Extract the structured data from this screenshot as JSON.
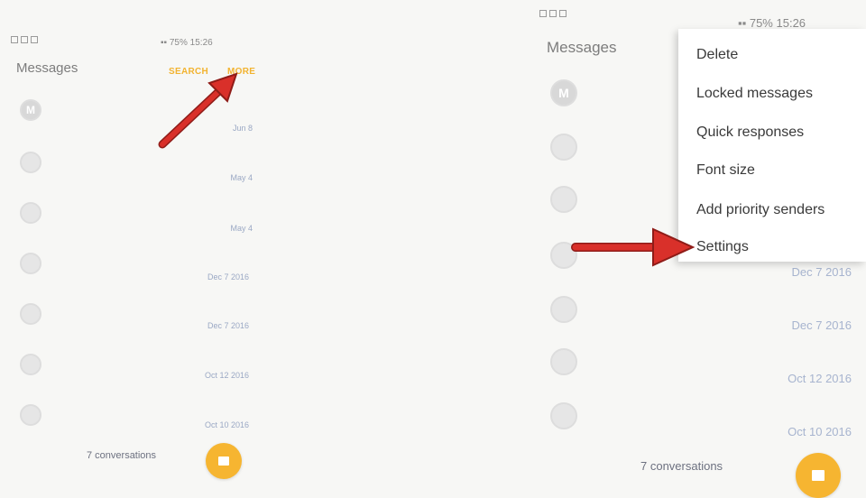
{
  "left": {
    "status_time": "15:26",
    "status_battery": "75%",
    "title": "Messages",
    "actions": {
      "search": "SEARCH",
      "more": "MORE"
    },
    "avatar_letter": "M",
    "dates": [
      "Jun 8",
      "May 4",
      "May 4",
      "Dec 7 2016",
      "Dec 7 2016",
      "Oct 12 2016",
      "Oct 10 2016"
    ],
    "conversations": "7 conversations"
  },
  "right": {
    "status_time": "15:26",
    "status_battery": "75%",
    "title": "Messages",
    "avatar_letter": "M",
    "dates": [
      "Dec 7 2016",
      "Dec 7 2016",
      "Oct 12 2016",
      "Oct 10 2016"
    ],
    "conversations": "7 conversations",
    "menu": [
      "Delete",
      "Locked messages",
      "Quick responses",
      "Font size",
      "Add priority senders",
      "Settings"
    ]
  },
  "colors": {
    "accent": "#f6b531",
    "arrow": "#d9302a",
    "date": "#9aa8c4"
  },
  "icons": {
    "compose": "compose-icon",
    "contact": "contact-avatar-icon"
  }
}
